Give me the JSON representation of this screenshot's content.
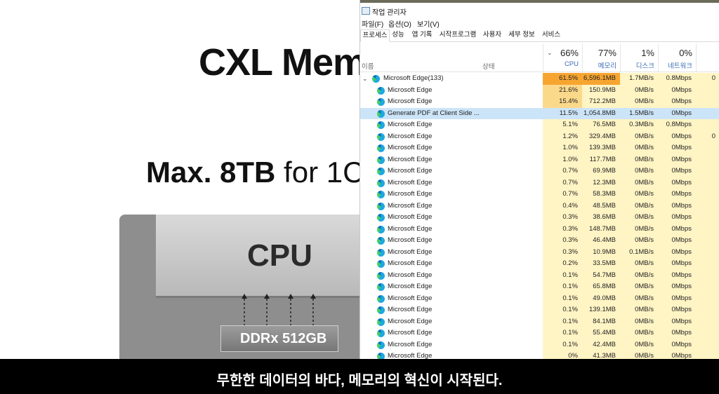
{
  "slide": {
    "title": "CXL Mem",
    "subtitle_bold": "Max. 8TB",
    "subtitle_rest": " for 1C",
    "cpu_label": "CPU",
    "ddr_label": "DDRx 512GB"
  },
  "taskmgr": {
    "title": "작업 관리자",
    "menus": [
      "파일(F)",
      "옵션(O)",
      "보기(V)"
    ],
    "tabs": [
      "프로세스",
      "성능",
      "앱 기록",
      "시작프로그램",
      "사용자",
      "세부 정보",
      "서비스"
    ],
    "header": {
      "name_label": "이름",
      "status_label": "상태",
      "cpu_pct": "66%",
      "cpu_label": "CPU",
      "mem_pct": "77%",
      "mem_label": "메모리",
      "disk_pct": "1%",
      "disk_label": "디스크",
      "net_pct": "0%",
      "net_label": "네트워크"
    },
    "rows": [
      {
        "name": "Microsoft Edge(133)",
        "cpu": "61.5%",
        "mem": "6,596.1MB",
        "disk": "1.7MB/s",
        "net": "0.8Mbps",
        "extra": "0"
      },
      {
        "name": "Microsoft Edge",
        "cpu": "21.6%",
        "mem": "150.9MB",
        "disk": "0MB/s",
        "net": "0Mbps"
      },
      {
        "name": "Microsoft Edge",
        "cpu": "15.4%",
        "mem": "712.2MB",
        "disk": "0MB/s",
        "net": "0Mbps"
      },
      {
        "name": "Generate PDF at Client Side ...",
        "cpu": "11.5%",
        "mem": "1,054.8MB",
        "disk": "1.5MB/s",
        "net": "0Mbps"
      },
      {
        "name": "Microsoft Edge",
        "cpu": "5.1%",
        "mem": "76.5MB",
        "disk": "0.3MB/s",
        "net": "0.8Mbps"
      },
      {
        "name": "Microsoft Edge",
        "cpu": "1.2%",
        "mem": "329.4MB",
        "disk": "0MB/s",
        "net": "0Mbps",
        "extra": "0"
      },
      {
        "name": "Microsoft Edge",
        "cpu": "1.0%",
        "mem": "139.3MB",
        "disk": "0MB/s",
        "net": "0Mbps"
      },
      {
        "name": "Microsoft Edge",
        "cpu": "1.0%",
        "mem": "117.7MB",
        "disk": "0MB/s",
        "net": "0Mbps"
      },
      {
        "name": "Microsoft Edge",
        "cpu": "0.7%",
        "mem": "69.9MB",
        "disk": "0MB/s",
        "net": "0Mbps"
      },
      {
        "name": "Microsoft Edge",
        "cpu": "0.7%",
        "mem": "12.3MB",
        "disk": "0MB/s",
        "net": "0Mbps"
      },
      {
        "name": "Microsoft Edge",
        "cpu": "0.7%",
        "mem": "58.3MB",
        "disk": "0MB/s",
        "net": "0Mbps"
      },
      {
        "name": "Microsoft Edge",
        "cpu": "0.4%",
        "mem": "48.5MB",
        "disk": "0MB/s",
        "net": "0Mbps"
      },
      {
        "name": "Microsoft Edge",
        "cpu": "0.3%",
        "mem": "38.6MB",
        "disk": "0MB/s",
        "net": "0Mbps"
      },
      {
        "name": "Microsoft Edge",
        "cpu": "0.3%",
        "mem": "148.7MB",
        "disk": "0MB/s",
        "net": "0Mbps"
      },
      {
        "name": "Microsoft Edge",
        "cpu": "0.3%",
        "mem": "46.4MB",
        "disk": "0MB/s",
        "net": "0Mbps"
      },
      {
        "name": "Microsoft Edge",
        "cpu": "0.3%",
        "mem": "10.9MB",
        "disk": "0.1MB/s",
        "net": "0Mbps"
      },
      {
        "name": "Microsoft Edge",
        "cpu": "0.2%",
        "mem": "33.5MB",
        "disk": "0MB/s",
        "net": "0Mbps"
      },
      {
        "name": "Microsoft Edge",
        "cpu": "0.1%",
        "mem": "54.7MB",
        "disk": "0MB/s",
        "net": "0Mbps"
      },
      {
        "name": "Microsoft Edge",
        "cpu": "0.1%",
        "mem": "65.8MB",
        "disk": "0MB/s",
        "net": "0Mbps"
      },
      {
        "name": "Microsoft Edge",
        "cpu": "0.1%",
        "mem": "49.0MB",
        "disk": "0MB/s",
        "net": "0Mbps"
      },
      {
        "name": "Microsoft Edge",
        "cpu": "0.1%",
        "mem": "139.1MB",
        "disk": "0MB/s",
        "net": "0Mbps"
      },
      {
        "name": "Microsoft Edge",
        "cpu": "0.1%",
        "mem": "84.1MB",
        "disk": "0MB/s",
        "net": "0Mbps"
      },
      {
        "name": "Microsoft Edge",
        "cpu": "0.1%",
        "mem": "55.4MB",
        "disk": "0MB/s",
        "net": "0Mbps"
      },
      {
        "name": "Microsoft Edge",
        "cpu": "0.1%",
        "mem": "42.4MB",
        "disk": "0MB/s",
        "net": "0Mbps"
      },
      {
        "name": "Microsoft Edge",
        "cpu": "0%",
        "mem": "41.3MB",
        "disk": "0MB/s",
        "net": "0Mbps"
      }
    ]
  },
  "caption": "무한한 데이터의 바다, 메모리의 혁신이 시작된다.",
  "colors": {
    "cpu_high": "#f7a531",
    "cpu_mid": "#fbd98b",
    "cell_low": "#fff4c4",
    "selected": "#cce4f7",
    "header_accent": "#3b6db5"
  }
}
